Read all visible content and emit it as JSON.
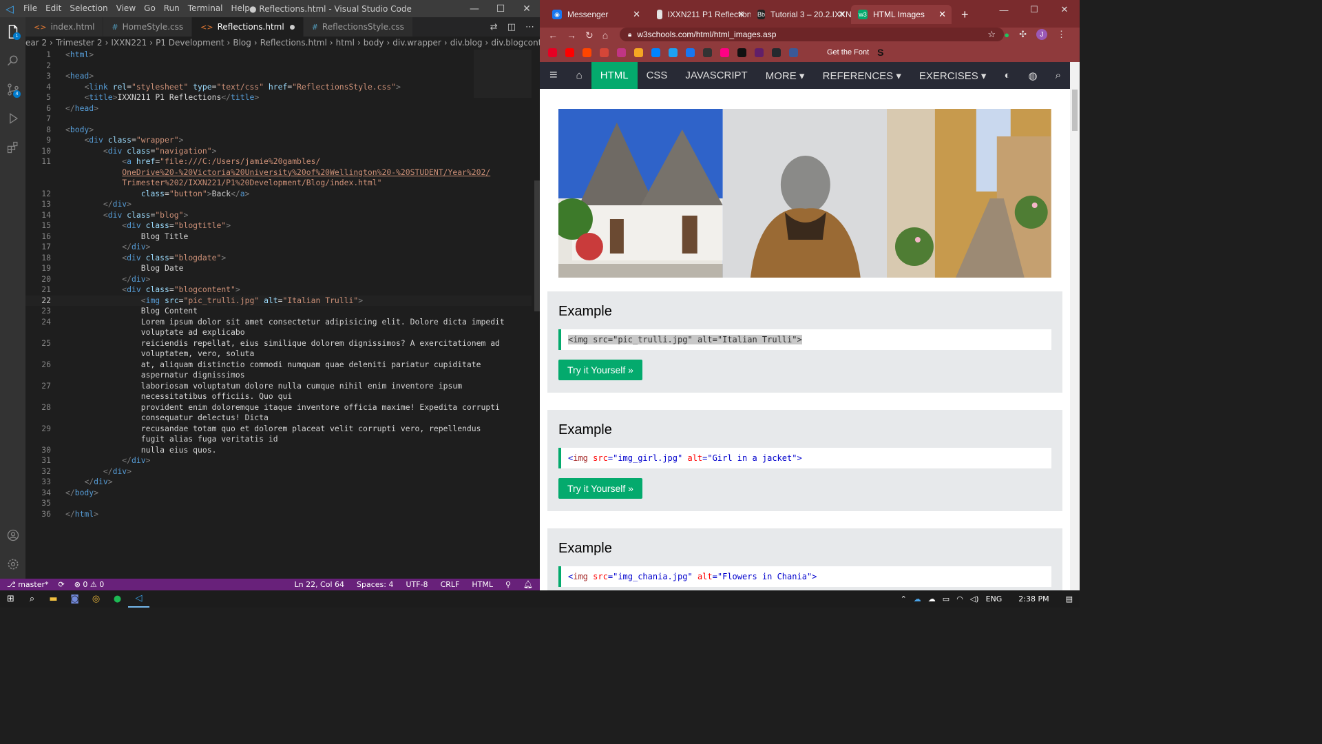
{
  "vscode": {
    "window_title": "● Reflections.html - Visual Studio Code",
    "menu": [
      "File",
      "Edit",
      "Selection",
      "View",
      "Go",
      "Run",
      "Terminal",
      "Help"
    ],
    "tabs": [
      {
        "icon": "<>",
        "label": "index.html",
        "active": false
      },
      {
        "icon": "#",
        "label": "HomeStyle.css",
        "active": false
      },
      {
        "icon": "<>",
        "label": "Reflections.html",
        "active": true,
        "dirty": true
      },
      {
        "icon": "#",
        "label": "ReflectionsStyle.css",
        "active": false
      }
    ],
    "breadcrumb": [
      "ear 2",
      "Trimester 2",
      "IXXN221",
      "P1 Development",
      "Blog",
      "Reflections.html",
      "html",
      "body",
      "div.wrapper",
      "div.blog",
      "div.blogcontent"
    ],
    "code_lines": [
      {
        "n": "1",
        "html": "<span class='p'>&lt;</span><span class='t'>html</span><span class='p'>&gt;</span>"
      },
      {
        "n": "2",
        "html": ""
      },
      {
        "n": "3",
        "html": "<span class='p'>&lt;</span><span class='t'>head</span><span class='p'>&gt;</span>"
      },
      {
        "n": "4",
        "html": "    <span class='p'>&lt;</span><span class='t'>link</span> <span class='a'>rel</span>=<span class='s'>\"stylesheet\"</span> <span class='a'>type</span>=<span class='s'>\"text/css\"</span> <span class='a'>href</span>=<span class='s'>\"<span class='u'>ReflectionsStyle.css</span>\"</span><span class='p'>&gt;</span>"
      },
      {
        "n": "5",
        "html": "    <span class='p'>&lt;</span><span class='t'>title</span><span class='p'>&gt;</span>IXXN211 P1 Reflections<span class='p'>&lt;/</span><span class='t'>title</span><span class='p'>&gt;</span>"
      },
      {
        "n": "6",
        "html": "<span class='p'>&lt;/</span><span class='t'>head</span><span class='p'>&gt;</span>"
      },
      {
        "n": "7",
        "html": ""
      },
      {
        "n": "8",
        "html": "<span class='p'>&lt;</span><span class='t'>body</span><span class='p'>&gt;</span>"
      },
      {
        "n": "9",
        "html": "    <span class='p'>&lt;</span><span class='t'>div</span> <span class='a'>class</span>=<span class='s'>\"wrapper\"</span><span class='p'>&gt;</span>"
      },
      {
        "n": "10",
        "html": "        <span class='p'>&lt;</span><span class='t'>div</span> <span class='a'>class</span>=<span class='s'>\"navigation\"</span><span class='p'>&gt;</span>"
      },
      {
        "n": "11",
        "html": "            <span class='p'>&lt;</span><span class='t'>a</span> <span class='a'>href</span>=<span class='s'>\"<span class='u'>file:///C:/Users/jamie%20gambles/</span></span>"
      },
      {
        "n": "",
        "html": "            <span class='s u'>OneDrive%20-%20Victoria%20University%20of%20Wellington%20-%20STUDENT/Year%202/</span>"
      },
      {
        "n": "",
        "html": "            <span class='s'><span class='u'>Trimester%202/IXXN221/P1%20Development/Blog/index.html</span>\"</span>"
      },
      {
        "n": "12",
        "html": "                <span class='a'>class</span>=<span class='s'>\"button\"</span><span class='p'>&gt;</span>Back<span class='p'>&lt;/</span><span class='t'>a</span><span class='p'>&gt;</span>"
      },
      {
        "n": "13",
        "html": "        <span class='p'>&lt;/</span><span class='t'>div</span><span class='p'>&gt;</span>"
      },
      {
        "n": "14",
        "html": "        <span class='p'>&lt;</span><span class='t'>div</span> <span class='a'>class</span>=<span class='s'>\"blog\"</span><span class='p'>&gt;</span>"
      },
      {
        "n": "15",
        "html": "            <span class='p'>&lt;</span><span class='t'>div</span> <span class='a'>class</span>=<span class='s'>\"blogtitle\"</span><span class='p'>&gt;</span>"
      },
      {
        "n": "16",
        "html": "                Blog Title"
      },
      {
        "n": "17",
        "html": "            <span class='p'>&lt;/</span><span class='t'>div</span><span class='p'>&gt;</span>"
      },
      {
        "n": "18",
        "html": "            <span class='p'>&lt;</span><span class='t'>div</span> <span class='a'>class</span>=<span class='s'>\"blogdate\"</span><span class='p'>&gt;</span>"
      },
      {
        "n": "19",
        "html": "                Blog Date"
      },
      {
        "n": "20",
        "html": "            <span class='p'>&lt;/</span><span class='t'>div</span><span class='p'>&gt;</span>"
      },
      {
        "n": "21",
        "html": "            <span class='p'>&lt;</span><span class='t'>div</span> <span class='a'>class</span>=<span class='s'>\"blogcontent\"</span><span class='p'>&gt;</span>"
      },
      {
        "n": "22",
        "html": "                <span class='p'>&lt;</span><span class='t'>img</span> <span class='a'>src</span>=<span class='s'>\"<span class='u'>pic_trulli.jpg</span>\"</span> <span class='a'>alt</span>=<span class='s'>\"Italian Trulli\"</span><span class='p'>&gt;</span>",
        "cur": true
      },
      {
        "n": "23",
        "html": "                Blog Content"
      },
      {
        "n": "24",
        "html": "                Lorem ipsum dolor sit amet consectetur adipisicing elit. Dolore dicta impedit"
      },
      {
        "n": "",
        "html": "                voluptate ad explicabo"
      },
      {
        "n": "25",
        "html": "                reiciendis repellat, eius similique dolorem dignissimos? A exercitationem ad"
      },
      {
        "n": "",
        "html": "                voluptatem, vero, soluta"
      },
      {
        "n": "26",
        "html": "                at, aliquam distinctio commodi numquam quae deleniti pariatur cupiditate"
      },
      {
        "n": "",
        "html": "                aspernatur dignissimos"
      },
      {
        "n": "27",
        "html": "                laboriosam voluptatum dolore nulla cumque nihil enim inventore ipsum"
      },
      {
        "n": "",
        "html": "                necessitatibus officiis. Quo qui"
      },
      {
        "n": "28",
        "html": "                provident enim doloremque itaque inventore officia maxime! Expedita corrupti"
      },
      {
        "n": "",
        "html": "                consequatur delectus! Dicta"
      },
      {
        "n": "29",
        "html": "                recusandae totam quo et dolorem placeat velit corrupti vero, repellendus"
      },
      {
        "n": "",
        "html": "                fugit alias fuga veritatis id"
      },
      {
        "n": "30",
        "html": "                nulla eius quos."
      },
      {
        "n": "31",
        "html": "            <span class='p'>&lt;/</span><span class='t'>div</span><span class='p'>&gt;</span>"
      },
      {
        "n": "32",
        "html": "        <span class='p'>&lt;/</span><span class='t'>div</span><span class='p'>&gt;</span>"
      },
      {
        "n": "33",
        "html": "    <span class='p'>&lt;/</span><span class='t'>div</span><span class='p'>&gt;</span>"
      },
      {
        "n": "34",
        "html": "<span class='p'>&lt;/</span><span class='t'>body</span><span class='p'>&gt;</span>"
      },
      {
        "n": "35",
        "html": ""
      },
      {
        "n": "36",
        "html": "<span class='p'>&lt;/</span><span class='t'>html</span><span class='p'>&gt;</span>"
      }
    ],
    "status": {
      "branch": "master*",
      "errors": "0",
      "warnings": "0",
      "position": "Ln 22, Col 64",
      "spaces": "Spaces: 4",
      "encoding": "UTF-8",
      "eol": "CRLF",
      "language": "HTML"
    },
    "activity_badges": {
      "explorer": "1",
      "scm": "4"
    }
  },
  "chrome": {
    "tabs": [
      {
        "label": "Messenger",
        "fav_color": "#1877f2",
        "fav_glyph": "◉"
      },
      {
        "label": "IXXN211 P1 Reflection",
        "fav_color": "#e0e0e0",
        "fav_glyph": "⊕"
      },
      {
        "label": "Tutorial 3 – 20.2.IXXN",
        "fav_color": "#222",
        "fav_glyph": "Bb"
      },
      {
        "label": "HTML Images",
        "fav_color": "#04aa6d",
        "fav_glyph": "w3",
        "active": true
      }
    ],
    "url": "w3schools.com/html/html_images.asp",
    "avatar_letter": "J",
    "bookmark_text": "Get the Font",
    "bookmark_s": "S",
    "bookmark_colors": [
      "#e60023",
      "#ff0000",
      "#ff4500",
      "#d44638",
      "#c13584",
      "#f5a623",
      "#0084ff",
      "#1da1f2",
      "#1877f2",
      "#333",
      "#ff0084",
      "#111",
      "#611f69",
      "#24292e",
      "#3b5998"
    ]
  },
  "w3": {
    "nav": [
      {
        "label": "HTML",
        "active": true
      },
      {
        "label": "CSS"
      },
      {
        "label": "JAVASCRIPT"
      },
      {
        "label": "MORE ▾"
      }
    ],
    "nav_right": [
      "REFERENCES ▾",
      "EXERCISES ▾"
    ],
    "examples": [
      {
        "title": "Example",
        "src": "pic_trulli.jpg",
        "alt": "Italian Trulli",
        "selected": true,
        "button": "Try it Yourself »"
      },
      {
        "title": "Example",
        "src": "img_girl.jpg",
        "alt": "Girl in a jacket",
        "button": "Try it Yourself »"
      },
      {
        "title": "Example",
        "src": "img_chania.jpg",
        "alt": "Flowers in Chania"
      }
    ]
  },
  "taskbar": {
    "tray_lang": "ENG",
    "time": "2:38 PM"
  }
}
